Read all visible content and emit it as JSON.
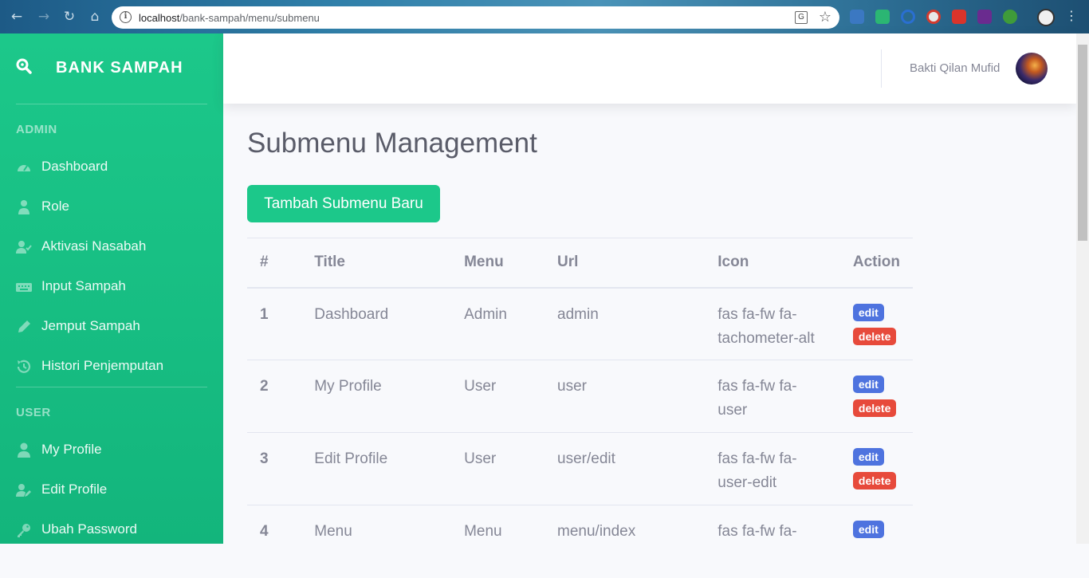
{
  "browser": {
    "url_host": "localhost",
    "url_path": "/bank-sampah/menu/submenu"
  },
  "brand": {
    "title": "BANK SAMPAH"
  },
  "sidebar": {
    "sections": [
      {
        "heading": "ADMIN"
      },
      {
        "heading": "USER"
      }
    ],
    "items": [
      {
        "label": "Dashboard",
        "icon": "tachometer-icon"
      },
      {
        "label": "Role",
        "icon": "user-tie-icon"
      },
      {
        "label": "Aktivasi Nasabah",
        "icon": "user-check-icon"
      },
      {
        "label": "Input Sampah",
        "icon": "keyboard-icon"
      },
      {
        "label": "Jemput Sampah",
        "icon": "pen-icon"
      },
      {
        "label": "Histori Penjemputan",
        "icon": "history-icon"
      },
      {
        "label": "My Profile",
        "icon": "user-icon"
      },
      {
        "label": "Edit Profile",
        "icon": "user-edit-icon"
      },
      {
        "label": "Ubah Password",
        "icon": "key-icon"
      }
    ]
  },
  "topbar": {
    "user_name": "Bakti Qilan Mufid"
  },
  "main": {
    "title": "Submenu Management",
    "add_button": "Tambah Submenu Baru",
    "table": {
      "headers": [
        "#",
        "Title",
        "Menu",
        "Url",
        "Icon",
        "Action"
      ],
      "rows": [
        {
          "num": "1",
          "title": "Dashboard",
          "menu": "Admin",
          "url": "admin",
          "icon_line1": "fas fa-fw fa-",
          "icon_line2": "tachometer-alt"
        },
        {
          "num": "2",
          "title": "My Profile",
          "menu": "User",
          "url": "user",
          "icon_line1": "fas fa-fw fa-",
          "icon_line2": "user"
        },
        {
          "num": "3",
          "title": "Edit Profile",
          "menu": "User",
          "url": "user/edit",
          "icon_line1": "fas fa-fw fa-",
          "icon_line2": "user-edit"
        },
        {
          "num": "4",
          "title": "Menu",
          "menu": "Menu",
          "url": "menu/index",
          "icon_line1": "fas fa-fw fa-",
          "icon_line2": ""
        }
      ],
      "edit_label": "edit",
      "delete_label": "delete"
    }
  },
  "colors": {
    "sidebar": "#1cc88a",
    "primary": "#4e73df",
    "danger": "#e74a3b",
    "text": "#858796",
    "title": "#5a5c69"
  }
}
